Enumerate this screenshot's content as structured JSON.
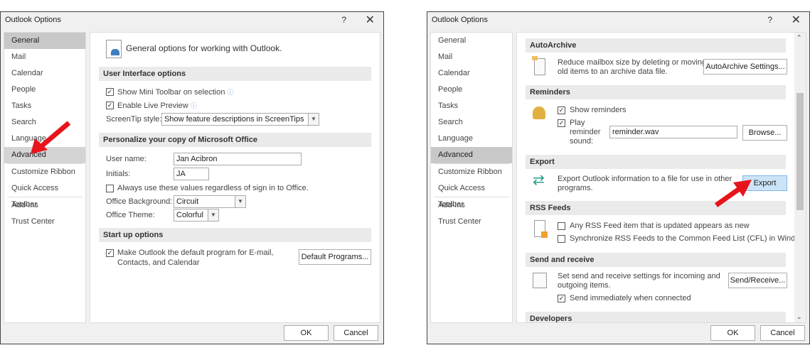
{
  "window": {
    "title": "Outlook Options",
    "help": "?",
    "close": "✕"
  },
  "sidebar": [
    "General",
    "Mail",
    "Calendar",
    "People",
    "Tasks",
    "Search",
    "Language",
    "Advanced",
    "Customize Ribbon",
    "Quick Access Toolbar",
    "Add-Ins",
    "Trust Center"
  ],
  "footer": {
    "ok": "OK",
    "cancel": "Cancel"
  },
  "general": {
    "heading": "General options for working with Outlook.",
    "ui_section": "User Interface options",
    "mini_toolbar": "Show Mini Toolbar on selection",
    "live_preview": "Enable Live Preview",
    "screentip_label": "ScreenTip style:",
    "screentip_value": "Show feature descriptions in ScreenTips",
    "personalize_section": "Personalize your copy of Microsoft Office",
    "username_label": "User name:",
    "username_value": "Jan Acibron",
    "initials_label": "Initials:",
    "initials_value": "JA",
    "always_use": "Always use these values regardless of sign in to Office.",
    "background_label": "Office Background:",
    "background_value": "Circuit",
    "theme_label": "Office Theme:",
    "theme_value": "Colorful",
    "startup_section": "Start up options",
    "default_program_1": "Make Outlook the default program for E-mail,",
    "default_program_2": "Contacts, and Calendar",
    "default_programs_button": "Default Programs..."
  },
  "advanced": {
    "autoarchive_section": "AutoArchive",
    "autoarchive_text_1": "Reduce mailbox size by deleting or moving",
    "autoarchive_text_2": "old items to an archive data file.",
    "autoarchive_button": "AutoArchive Settings...",
    "reminders_section": "Reminders",
    "show_reminders": "Show reminders",
    "play_1": "Play",
    "play_2": "reminder",
    "play_3": "sound:",
    "sound_file": "reminder.wav",
    "browse_button": "Browse...",
    "export_section": "Export",
    "export_text_1": "Export Outlook information to a file for use in other",
    "export_text_2": "programs.",
    "export_button": "Export",
    "rss_section": "RSS Feeds",
    "rss_item_1": "Any RSS Feed item that is updated appears as new",
    "rss_item_2": "Synchronize RSS Feeds to the Common Feed List (CFL) in Windows",
    "send_section": "Send and receive",
    "send_text_1": "Set send and receive settings for incoming and",
    "send_text_2": "outgoing items.",
    "send_button": "Send/Receive...",
    "send_immediately": "Send immediately when connected",
    "developers_section": "Developers"
  },
  "colors": {
    "arrow": "#e8141c",
    "export_button": "#cce4f7"
  }
}
